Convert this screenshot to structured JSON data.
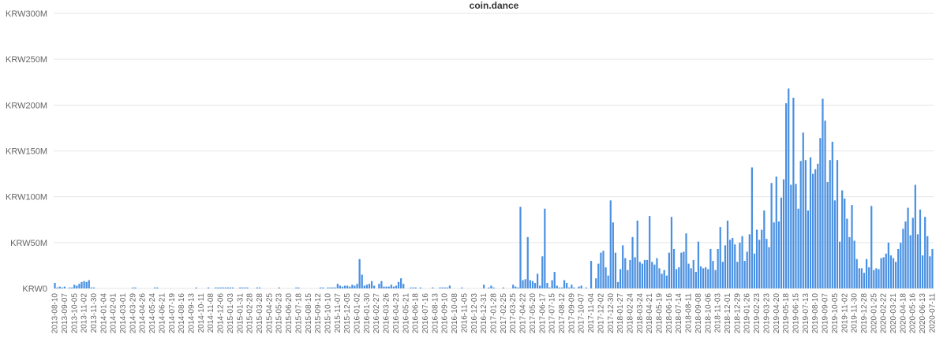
{
  "colors": {
    "bar": "#4a90e2",
    "grid": "#e6e6e6",
    "text": "#666666"
  },
  "chart_data": {
    "type": "bar",
    "title": "coin.dance",
    "xlabel": "",
    "ylabel": "",
    "ylim": [
      0,
      300000000
    ],
    "y_ticks": [
      0,
      50000000,
      100000000,
      150000000,
      200000000,
      250000000,
      300000000
    ],
    "y_tick_labels": [
      "KRW0",
      "KRW50M",
      "KRW100M",
      "KRW150M",
      "KRW200M",
      "KRW250M",
      "KRW300M"
    ],
    "x_tick_labels": [
      "2013-08-10",
      "2013-09-07",
      "2013-10-05",
      "2013-11-02",
      "2013-11-30",
      "2014-01-04",
      "2014-02-01",
      "2014-03-01",
      "2014-03-29",
      "2014-04-26",
      "2014-05-24",
      "2014-06-21",
      "2014-07-19",
      "2014-08-16",
      "2014-09-13",
      "2014-10-11",
      "2014-11-08",
      "2014-12-06",
      "2015-01-03",
      "2015-01-31",
      "2015-02-28",
      "2015-03-28",
      "2015-04-25",
      "2015-05-23",
      "2015-06-20",
      "2015-07-18",
      "2015-08-15",
      "2015-09-12",
      "2015-10-10",
      "2015-11-07",
      "2015-12-05",
      "2016-01-02",
      "2016-01-30",
      "2016-02-27",
      "2016-03-26",
      "2016-04-23",
      "2016-05-21",
      "2016-06-18",
      "2016-07-16",
      "2016-08-13",
      "2016-09-10",
      "2016-10-08",
      "2016-11-05",
      "2016-12-03",
      "2016-12-31",
      "2017-01-28",
      "2017-02-25",
      "2017-03-25",
      "2017-04-22",
      "2017-05-20",
      "2017-06-17",
      "2017-07-15",
      "2017-08-12",
      "2017-09-09",
      "2017-10-07",
      "2017-11-04",
      "2017-12-02",
      "2017-12-30",
      "2018-01-27",
      "2018-02-24",
      "2018-03-24",
      "2018-04-21",
      "2018-05-19",
      "2018-06-16",
      "2018-07-14",
      "2018-08-11",
      "2018-09-08",
      "2018-10-06",
      "2018-11-03",
      "2018-12-01",
      "2018-12-29",
      "2019-01-26",
      "2019-02-23",
      "2019-03-23",
      "2019-04-20",
      "2019-05-18",
      "2019-06-15",
      "2019-07-13",
      "2019-08-10",
      "2019-09-07",
      "2019-10-05",
      "2019-11-02",
      "2019-11-30",
      "2019-12-28",
      "2020-01-25",
      "2020-02-22",
      "2020-03-21",
      "2020-04-18",
      "2020-05-16",
      "2020-06-13",
      "2020-07-11"
    ],
    "x_tick_every": 4,
    "series": [
      {
        "values": [
          6,
          1,
          2,
          1,
          2,
          0,
          1,
          1,
          4,
          3,
          5,
          7,
          8,
          7,
          9,
          1,
          1,
          0,
          0,
          0,
          0,
          0,
          0,
          0,
          0,
          0,
          0,
          0,
          0,
          0,
          0,
          0,
          1,
          1,
          0,
          0,
          0,
          0,
          0,
          0,
          0,
          1,
          1,
          0,
          0,
          0,
          0,
          0,
          0,
          0,
          0,
          0,
          0,
          0,
          0,
          0,
          0,
          0,
          1,
          0,
          0,
          0,
          0,
          1,
          0,
          0,
          1,
          1,
          1,
          1,
          1,
          1,
          1,
          1,
          0,
          0,
          1,
          1,
          1,
          1,
          0,
          0,
          0,
          1,
          1,
          0,
          0,
          0,
          0,
          0,
          0,
          0,
          1,
          0,
          0,
          0,
          0,
          0,
          0,
          1,
          1,
          0,
          0,
          0,
          0,
          0,
          0,
          0,
          0,
          1,
          1,
          0,
          1,
          1,
          1,
          1,
          5,
          3,
          2,
          3,
          3,
          2,
          4,
          3,
          5,
          32,
          15,
          3,
          4,
          5,
          8,
          3,
          0,
          5,
          8,
          2,
          2,
          2,
          4,
          2,
          3,
          7,
          11,
          5,
          0,
          0,
          1,
          1,
          1,
          0,
          1,
          0,
          0,
          0,
          0,
          1,
          0,
          0,
          1,
          1,
          1,
          1,
          3,
          0,
          0,
          0,
          0,
          1,
          0,
          0,
          0,
          0,
          0,
          0,
          0,
          0,
          4,
          0,
          1,
          3,
          1,
          0,
          0,
          0,
          1,
          0,
          0,
          0,
          4,
          2,
          1,
          89,
          9,
          10,
          56,
          9,
          8,
          6,
          16,
          3,
          35,
          87,
          6,
          1,
          9,
          18,
          3,
          1,
          1,
          9,
          6,
          1,
          4,
          1,
          0,
          2,
          3,
          0,
          1,
          0,
          30,
          0,
          11,
          27,
          39,
          41,
          23,
          14,
          96,
          72,
          39,
          7,
          21,
          47,
          33,
          20,
          31,
          56,
          34,
          74,
          29,
          27,
          31,
          31,
          79,
          29,
          26,
          33,
          22,
          16,
          20,
          14,
          39,
          78,
          43,
          21,
          23,
          39,
          40,
          60,
          27,
          22,
          31,
          18,
          51,
          24,
          22,
          23,
          21,
          43,
          30,
          20,
          43,
          67,
          29,
          47,
          74,
          53,
          55,
          48,
          29,
          50,
          57,
          30,
          40,
          59,
          132,
          38,
          64,
          53,
          64,
          85,
          54,
          45,
          115,
          72,
          122,
          73,
          99,
          119,
          202,
          218,
          113,
          208,
          114,
          87,
          139,
          170,
          140,
          85,
          143,
          125,
          130,
          136,
          164,
          207,
          183,
          116,
          140,
          160,
          96,
          140,
          51,
          107,
          98,
          76,
          56,
          91,
          52,
          32,
          22,
          22,
          17,
          32,
          23,
          90,
          20,
          22,
          21,
          33,
          34,
          38,
          50,
          36,
          33,
          29,
          43,
          50,
          65,
          73,
          88,
          58,
          77,
          113,
          59,
          86,
          36,
          78,
          57,
          35,
          43
        ]
      }
    ]
  }
}
